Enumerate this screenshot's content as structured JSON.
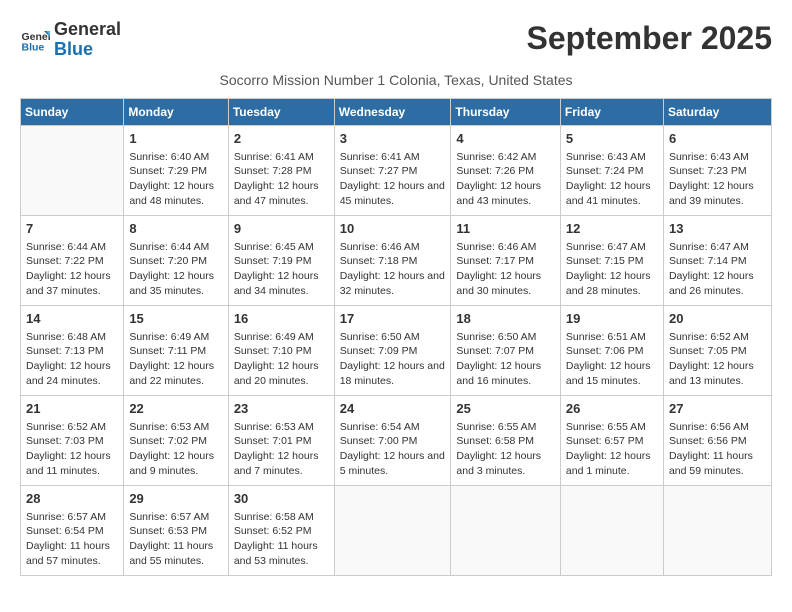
{
  "logo": {
    "line1": "General",
    "line2": "Blue"
  },
  "title": "September 2025",
  "subtitle": "Socorro Mission Number 1 Colonia, Texas, United States",
  "days_of_week": [
    "Sunday",
    "Monday",
    "Tuesday",
    "Wednesday",
    "Thursday",
    "Friday",
    "Saturday"
  ],
  "weeks": [
    [
      {
        "day": "",
        "sunrise": "",
        "sunset": "",
        "daylight": ""
      },
      {
        "day": "1",
        "sunrise": "Sunrise: 6:40 AM",
        "sunset": "Sunset: 7:29 PM",
        "daylight": "Daylight: 12 hours and 48 minutes."
      },
      {
        "day": "2",
        "sunrise": "Sunrise: 6:41 AM",
        "sunset": "Sunset: 7:28 PM",
        "daylight": "Daylight: 12 hours and 47 minutes."
      },
      {
        "day": "3",
        "sunrise": "Sunrise: 6:41 AM",
        "sunset": "Sunset: 7:27 PM",
        "daylight": "Daylight: 12 hours and 45 minutes."
      },
      {
        "day": "4",
        "sunrise": "Sunrise: 6:42 AM",
        "sunset": "Sunset: 7:26 PM",
        "daylight": "Daylight: 12 hours and 43 minutes."
      },
      {
        "day": "5",
        "sunrise": "Sunrise: 6:43 AM",
        "sunset": "Sunset: 7:24 PM",
        "daylight": "Daylight: 12 hours and 41 minutes."
      },
      {
        "day": "6",
        "sunrise": "Sunrise: 6:43 AM",
        "sunset": "Sunset: 7:23 PM",
        "daylight": "Daylight: 12 hours and 39 minutes."
      }
    ],
    [
      {
        "day": "7",
        "sunrise": "Sunrise: 6:44 AM",
        "sunset": "Sunset: 7:22 PM",
        "daylight": "Daylight: 12 hours and 37 minutes."
      },
      {
        "day": "8",
        "sunrise": "Sunrise: 6:44 AM",
        "sunset": "Sunset: 7:20 PM",
        "daylight": "Daylight: 12 hours and 35 minutes."
      },
      {
        "day": "9",
        "sunrise": "Sunrise: 6:45 AM",
        "sunset": "Sunset: 7:19 PM",
        "daylight": "Daylight: 12 hours and 34 minutes."
      },
      {
        "day": "10",
        "sunrise": "Sunrise: 6:46 AM",
        "sunset": "Sunset: 7:18 PM",
        "daylight": "Daylight: 12 hours and 32 minutes."
      },
      {
        "day": "11",
        "sunrise": "Sunrise: 6:46 AM",
        "sunset": "Sunset: 7:17 PM",
        "daylight": "Daylight: 12 hours and 30 minutes."
      },
      {
        "day": "12",
        "sunrise": "Sunrise: 6:47 AM",
        "sunset": "Sunset: 7:15 PM",
        "daylight": "Daylight: 12 hours and 28 minutes."
      },
      {
        "day": "13",
        "sunrise": "Sunrise: 6:47 AM",
        "sunset": "Sunset: 7:14 PM",
        "daylight": "Daylight: 12 hours and 26 minutes."
      }
    ],
    [
      {
        "day": "14",
        "sunrise": "Sunrise: 6:48 AM",
        "sunset": "Sunset: 7:13 PM",
        "daylight": "Daylight: 12 hours and 24 minutes."
      },
      {
        "day": "15",
        "sunrise": "Sunrise: 6:49 AM",
        "sunset": "Sunset: 7:11 PM",
        "daylight": "Daylight: 12 hours and 22 minutes."
      },
      {
        "day": "16",
        "sunrise": "Sunrise: 6:49 AM",
        "sunset": "Sunset: 7:10 PM",
        "daylight": "Daylight: 12 hours and 20 minutes."
      },
      {
        "day": "17",
        "sunrise": "Sunrise: 6:50 AM",
        "sunset": "Sunset: 7:09 PM",
        "daylight": "Daylight: 12 hours and 18 minutes."
      },
      {
        "day": "18",
        "sunrise": "Sunrise: 6:50 AM",
        "sunset": "Sunset: 7:07 PM",
        "daylight": "Daylight: 12 hours and 16 minutes."
      },
      {
        "day": "19",
        "sunrise": "Sunrise: 6:51 AM",
        "sunset": "Sunset: 7:06 PM",
        "daylight": "Daylight: 12 hours and 15 minutes."
      },
      {
        "day": "20",
        "sunrise": "Sunrise: 6:52 AM",
        "sunset": "Sunset: 7:05 PM",
        "daylight": "Daylight: 12 hours and 13 minutes."
      }
    ],
    [
      {
        "day": "21",
        "sunrise": "Sunrise: 6:52 AM",
        "sunset": "Sunset: 7:03 PM",
        "daylight": "Daylight: 12 hours and 11 minutes."
      },
      {
        "day": "22",
        "sunrise": "Sunrise: 6:53 AM",
        "sunset": "Sunset: 7:02 PM",
        "daylight": "Daylight: 12 hours and 9 minutes."
      },
      {
        "day": "23",
        "sunrise": "Sunrise: 6:53 AM",
        "sunset": "Sunset: 7:01 PM",
        "daylight": "Daylight: 12 hours and 7 minutes."
      },
      {
        "day": "24",
        "sunrise": "Sunrise: 6:54 AM",
        "sunset": "Sunset: 7:00 PM",
        "daylight": "Daylight: 12 hours and 5 minutes."
      },
      {
        "day": "25",
        "sunrise": "Sunrise: 6:55 AM",
        "sunset": "Sunset: 6:58 PM",
        "daylight": "Daylight: 12 hours and 3 minutes."
      },
      {
        "day": "26",
        "sunrise": "Sunrise: 6:55 AM",
        "sunset": "Sunset: 6:57 PM",
        "daylight": "Daylight: 12 hours and 1 minute."
      },
      {
        "day": "27",
        "sunrise": "Sunrise: 6:56 AM",
        "sunset": "Sunset: 6:56 PM",
        "daylight": "Daylight: 11 hours and 59 minutes."
      }
    ],
    [
      {
        "day": "28",
        "sunrise": "Sunrise: 6:57 AM",
        "sunset": "Sunset: 6:54 PM",
        "daylight": "Daylight: 11 hours and 57 minutes."
      },
      {
        "day": "29",
        "sunrise": "Sunrise: 6:57 AM",
        "sunset": "Sunset: 6:53 PM",
        "daylight": "Daylight: 11 hours and 55 minutes."
      },
      {
        "day": "30",
        "sunrise": "Sunrise: 6:58 AM",
        "sunset": "Sunset: 6:52 PM",
        "daylight": "Daylight: 11 hours and 53 minutes."
      },
      {
        "day": "",
        "sunrise": "",
        "sunset": "",
        "daylight": ""
      },
      {
        "day": "",
        "sunrise": "",
        "sunset": "",
        "daylight": ""
      },
      {
        "day": "",
        "sunrise": "",
        "sunset": "",
        "daylight": ""
      },
      {
        "day": "",
        "sunrise": "",
        "sunset": "",
        "daylight": ""
      }
    ]
  ]
}
